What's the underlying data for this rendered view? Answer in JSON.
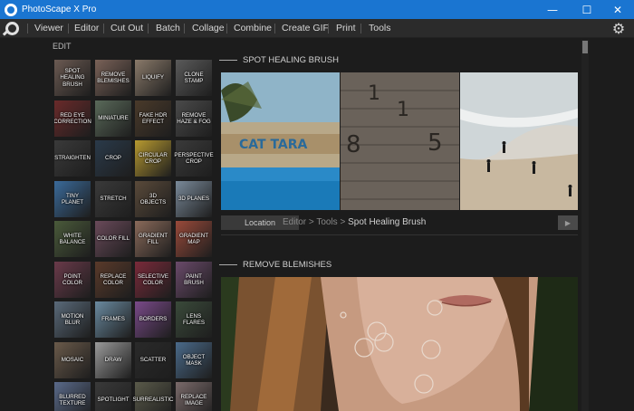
{
  "window": {
    "title": "PhotoScape X Pro",
    "min_glyph": "—",
    "max_glyph": "☐",
    "close_glyph": "✕"
  },
  "menu": {
    "items": [
      "Viewer",
      "Editor",
      "Cut Out",
      "Batch",
      "Collage",
      "Combine",
      "Create GIF",
      "Print",
      "Tools"
    ],
    "settings_glyph": "⚙"
  },
  "left_panel": {
    "label": "EDIT",
    "tools": [
      {
        "label": "SPOT HEALING BRUSH",
        "color": "#6b5a52"
      },
      {
        "label": "REMOVE BLEMISHES",
        "color": "#7a6258"
      },
      {
        "label": "LIQUIFY",
        "color": "#8a7a6a"
      },
      {
        "label": "CLONE STAMP",
        "color": "#5a5a5a"
      },
      {
        "label": "RED EYE CORRECTION",
        "color": "#6a2a2a"
      },
      {
        "label": "MINIATURE",
        "color": "#5a6a5a"
      },
      {
        "label": "FAKE HDR EFFECT",
        "color": "#4a3a2a"
      },
      {
        "label": "REMOVE HAZE & FOG",
        "color": "#4a4a4a"
      },
      {
        "label": "STRAIGHTEN",
        "color": "#3a3a3a"
      },
      {
        "label": "CROP",
        "color": "#2a3a4a"
      },
      {
        "label": "CIRCULAR CROP",
        "color": "#b89a30"
      },
      {
        "label": "PERSPECTIVE CROP",
        "color": "#3a3a3a"
      },
      {
        "label": "TINY PLANET",
        "color": "#3a6a9a"
      },
      {
        "label": "STRETCH",
        "color": "#3a3a3a"
      },
      {
        "label": "3D OBJECTS",
        "color": "#5a4a3a"
      },
      {
        "label": "3D PLANES",
        "color": "#7a8a9a"
      },
      {
        "label": "WHITE BALANCE",
        "color": "#4a5a3a"
      },
      {
        "label": "COLOR FILL",
        "color": "#6a4a5a"
      },
      {
        "label": "GRADIENT FILL",
        "color": "#8a6a5a"
      },
      {
        "label": "GRADIENT MAP",
        "color": "#9a4a3a"
      },
      {
        "label": "POINT COLOR",
        "color": "#6a3a4a"
      },
      {
        "label": "REPLACE COLOR",
        "color": "#5a3a2a"
      },
      {
        "label": "SELECTIVE COLOR",
        "color": "#7a2a3a"
      },
      {
        "label": "PAINT BRUSH",
        "color": "#6a4a6a"
      },
      {
        "label": "MOTION BLUR",
        "color": "#5a6a7a"
      },
      {
        "label": "FRAMES",
        "color": "#6a8aa0"
      },
      {
        "label": "BORDERS",
        "color": "#7a4a8a"
      },
      {
        "label": "LENS FLARES",
        "color": "#3a4a3a"
      },
      {
        "label": "MOSAIC",
        "color": "#6a5a4a"
      },
      {
        "label": "DRAW",
        "color": "#9a9a9a"
      },
      {
        "label": "SCATTER",
        "color": "#2a2a2a"
      },
      {
        "label": "OBJECT MASK",
        "color": "#4a6a8a"
      },
      {
        "label": "BLURRED TEXTURE",
        "color": "#5a6a8a"
      },
      {
        "label": "SPOTLIGHT",
        "color": "#3a3a3a"
      },
      {
        "label": "SURREALISTIC",
        "color": "#5a5a4a"
      },
      {
        "label": "REPLACE IMAGE",
        "color": "#7a6a6a"
      }
    ]
  },
  "main": {
    "sections": [
      {
        "title": "SPOT HEALING BRUSH"
      },
      {
        "title": "REMOVE BLEMISHES"
      }
    ],
    "location": {
      "button": "Location",
      "path": "Editor > Tools > ",
      "current": "Spot Healing Brush",
      "play_glyph": "▶"
    },
    "photo1_text": "CAT TARA",
    "photo2_digits": [
      "1",
      "1",
      "8",
      "5"
    ]
  }
}
